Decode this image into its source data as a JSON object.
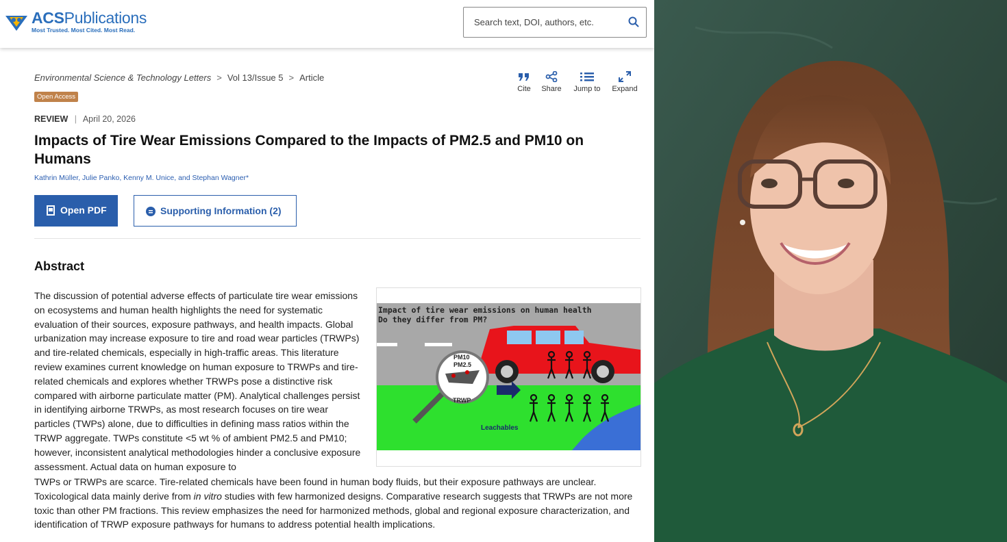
{
  "header": {
    "logo_name": "ACS",
    "logo_name_rest": "Publications",
    "logo_tagline": "Most Trusted. Most Cited. Most Read.",
    "search_placeholder": "Search text, DOI, authors, etc.",
    "search_icon": "search-icon"
  },
  "breadcrumb": {
    "journal": "Environmental Science & Technology Letters",
    "issue": "Vol 13/Issue 5",
    "type": "Article",
    "separator": ">"
  },
  "badge": "Open Access",
  "tools": [
    {
      "label": "Cite",
      "icon": "quote-icon"
    },
    {
      "label": "Share",
      "icon": "share-icon"
    },
    {
      "label": "Jump to",
      "icon": "list-icon"
    },
    {
      "label": "Expand",
      "icon": "expand-icon"
    }
  ],
  "meta": {
    "kind": "REVIEW",
    "divider": "|",
    "date": "April 20, 2026"
  },
  "title": "Impacts of Tire Wear Emissions Compared to the Impacts of PM2.5 and PM10 on Humans",
  "authors": "Kathrin Müller,  Julie Panko,  Kenny M. Unice,  and Stephan Wagner*",
  "buttons": {
    "pdf": "Open PDF",
    "si": "Supporting Information (2)"
  },
  "abstract": {
    "heading": "Abstract",
    "p1": "The discussion of potential adverse effects of particulate tire wear emissions on ecosystems and human health highlights the need for systematic evaluation of their sources, exposure pathways, and health impacts. Global urbanization may increase exposure to tire and road wear particles (TRWPs) and tire-related chemicals, especially in high-traffic areas. This literature review examines current knowledge on human exposure to TRWPs and tire-related chemicals and explores whether TRWPs pose a distinctive risk compared with airborne particulate matter (PM). Analytical challenges persist in identifying airborne TRWPs, as most research focuses on tire wear particles (TWPs) alone, due to difficulties in defining mass ratios within the TRWP aggregate. TWPs constitute <5 wt % of ambient PM2.5 and PM10; however, inconsistent analytical methodologies hinder a conclusive exposure assessment. Actual data on human exposure to",
    "p2_a": "TWPs or TRWPs are scarce. Tire-related chemicals have been found in human body fluids, but their exposure pathways are unclear. Toxicological data mainly derive from ",
    "p2_italic": "in vitro",
    "p2_b": " studies with few harmonized designs. Comparative research suggests that TRWPs are not more toxic than other PM fractions. This review emphasizes the need for harmonized methods, global and regional exposure characterization, and identification of TRWP exposure pathways for humans to address potential health implications."
  },
  "toc_graphic": {
    "line1": "Impact of tire wear emissions on human health",
    "line2": "Do they differ from PM?",
    "pm10": "PM10",
    "pm25": "PM2.5",
    "trwp": "TRWP",
    "leachables": "Leachables"
  },
  "colors": {
    "accent": "#2a5eab",
    "badge": "#c0824a",
    "car": "#e8141b",
    "grass": "#2ee02e",
    "road": "#a8a8a8",
    "board": "#2f4a3f",
    "sweater": "#1f5a3a"
  }
}
